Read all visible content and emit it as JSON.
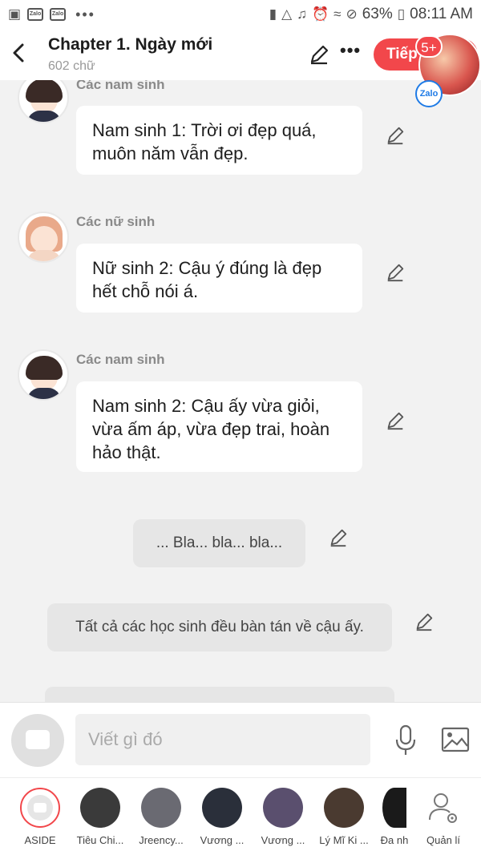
{
  "status_bar": {
    "battery": "63%",
    "time": "08:11 AM",
    "notification_apps": [
      "Zalo",
      "Zalo"
    ],
    "overflow": "•••"
  },
  "header": {
    "title": "Chapter 1. Ngày mới",
    "subtitle": "602 chữ",
    "next_label": "Tiếp",
    "badge": "5+",
    "bubble_app": "Zalo",
    "more": "•••"
  },
  "messages": [
    {
      "speaker": "Các nam sinh",
      "text": "Nam sinh 1: Trời ơi đẹp quá, muôn năm vẫn đẹp."
    },
    {
      "speaker": "Các nữ sinh",
      "text": "Nữ sinh 2: Cậu ý đúng là đẹp hết chỗ nói á."
    },
    {
      "speaker": "Các nam sinh",
      "text": "Nam sinh 2: Cậu ấy vừa giỏi, vừa ấm áp, vừa đẹp trai, hoàn hảo thật."
    }
  ],
  "narrations": [
    "... Bla... bla... bla...",
    "Tất cả các học sinh đều bàn tán về cậu ấy."
  ],
  "input": {
    "placeholder": "Viết gì đó"
  },
  "characters": [
    {
      "name": "ASIDE",
      "color": "#e6e6e6"
    },
    {
      "name": "Tiêu Chi...",
      "color": "#3a3a3a"
    },
    {
      "name": "Jreency...",
      "color": "#6a6a72"
    },
    {
      "name": "Vương ...",
      "color": "#2a2f3a"
    },
    {
      "name": "Vương ...",
      "color": "#5a4f6e"
    },
    {
      "name": "Lý Mĩ Ki ...",
      "color": "#4a3a30"
    },
    {
      "name": "Đa nh",
      "color": "#1a1a1a"
    },
    {
      "name": "Quản lí",
      "color": "#ffffff"
    }
  ]
}
